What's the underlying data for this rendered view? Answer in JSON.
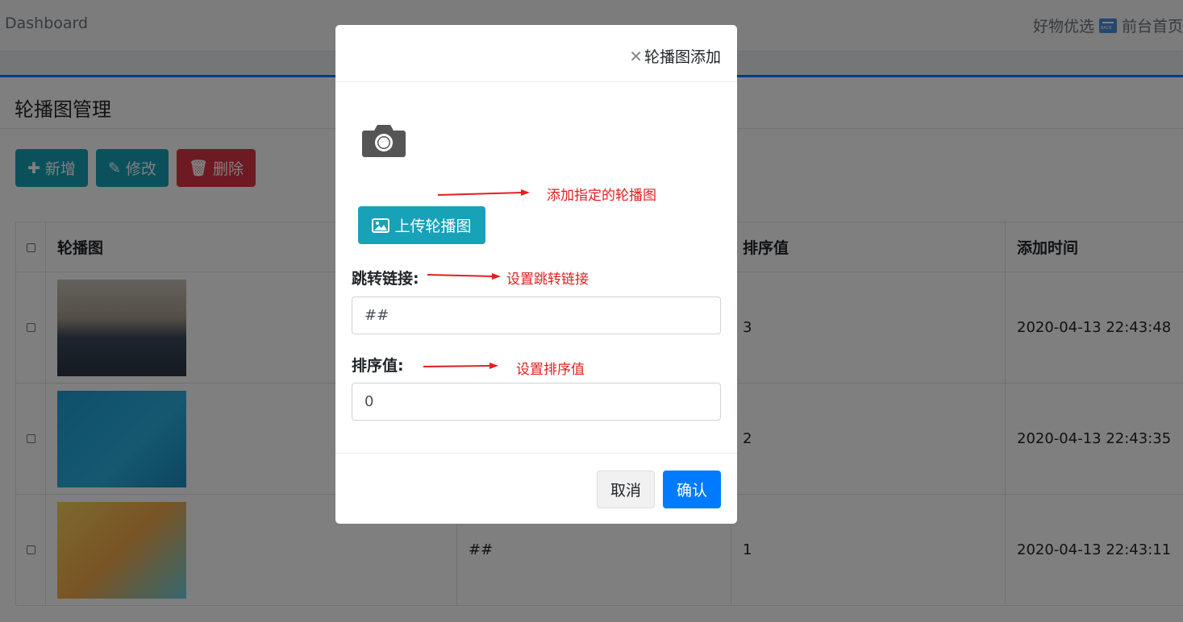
{
  "header": {
    "brand": "Dashboard",
    "right_label": "好物优选",
    "home_label": "前台首页"
  },
  "page": {
    "title": "轮播图管理"
  },
  "toolbar": {
    "add_label": "新增",
    "edit_label": "修改",
    "delete_label": "删除"
  },
  "table": {
    "columns": [
      "轮播图",
      "",
      "排序值",
      "添加时间"
    ],
    "rows": [
      {
        "image": "carousel-1",
        "link": "",
        "sort": "3",
        "time": "2020-04-13 22:43:48"
      },
      {
        "image": "carousel-2",
        "link": "",
        "sort": "2",
        "time": "2020-04-13 22:43:35"
      },
      {
        "image": "carousel-3",
        "link": "##",
        "sort": "1",
        "time": "2020-04-13 22:43:11"
      }
    ]
  },
  "modal": {
    "title": "轮播图添加",
    "upload_label": "上传轮播图",
    "link_label": "跳转链接:",
    "link_value": "##",
    "sort_label": "排序值:",
    "sort_value": "0",
    "cancel_label": "取消",
    "confirm_label": "确认"
  },
  "annotations": {
    "upload_note": "添加指定的轮播图",
    "link_note": "设置跳转链接",
    "sort_note": "设置排序值",
    "color": "#e02020"
  },
  "colors": {
    "primary": "#007bff",
    "teal": "#17a2b8",
    "danger": "#dc3545"
  }
}
